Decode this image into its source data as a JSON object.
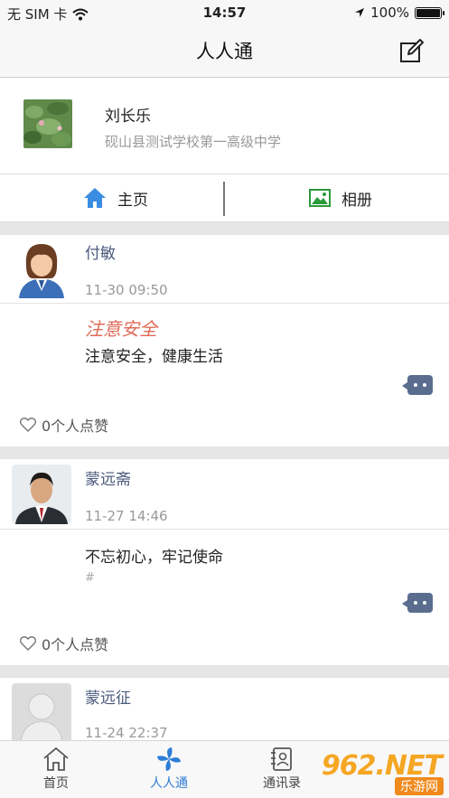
{
  "status": {
    "carrier": "无 SIM 卡",
    "time": "14:57",
    "battery": "100%",
    "battery_level": 1.0
  },
  "nav": {
    "title": "人人通"
  },
  "profile": {
    "name": "刘长乐",
    "school": "砚山县测试学校第一高级中学"
  },
  "tabs": {
    "home": "主页",
    "album": "相册"
  },
  "posts": [
    {
      "author": "付敏",
      "time": "11-30 09:50",
      "title": "注意安全",
      "text": "注意安全，健康生活",
      "likes": "0个人点赞"
    },
    {
      "author": "蒙远斋",
      "time": "11-27 14:46",
      "text": "不忘初心，牢记使命",
      "tag": "#",
      "likes": "0个人点赞"
    },
    {
      "author": "蒙远征",
      "time": "11-24 22:37"
    }
  ],
  "tabbar": {
    "items": [
      {
        "label": "首页"
      },
      {
        "label": "人人通"
      },
      {
        "label": "通讯录"
      }
    ],
    "active_color": "#2e7dd6"
  },
  "watermark": {
    "brand": "962.NET",
    "caption": "乐游网"
  }
}
